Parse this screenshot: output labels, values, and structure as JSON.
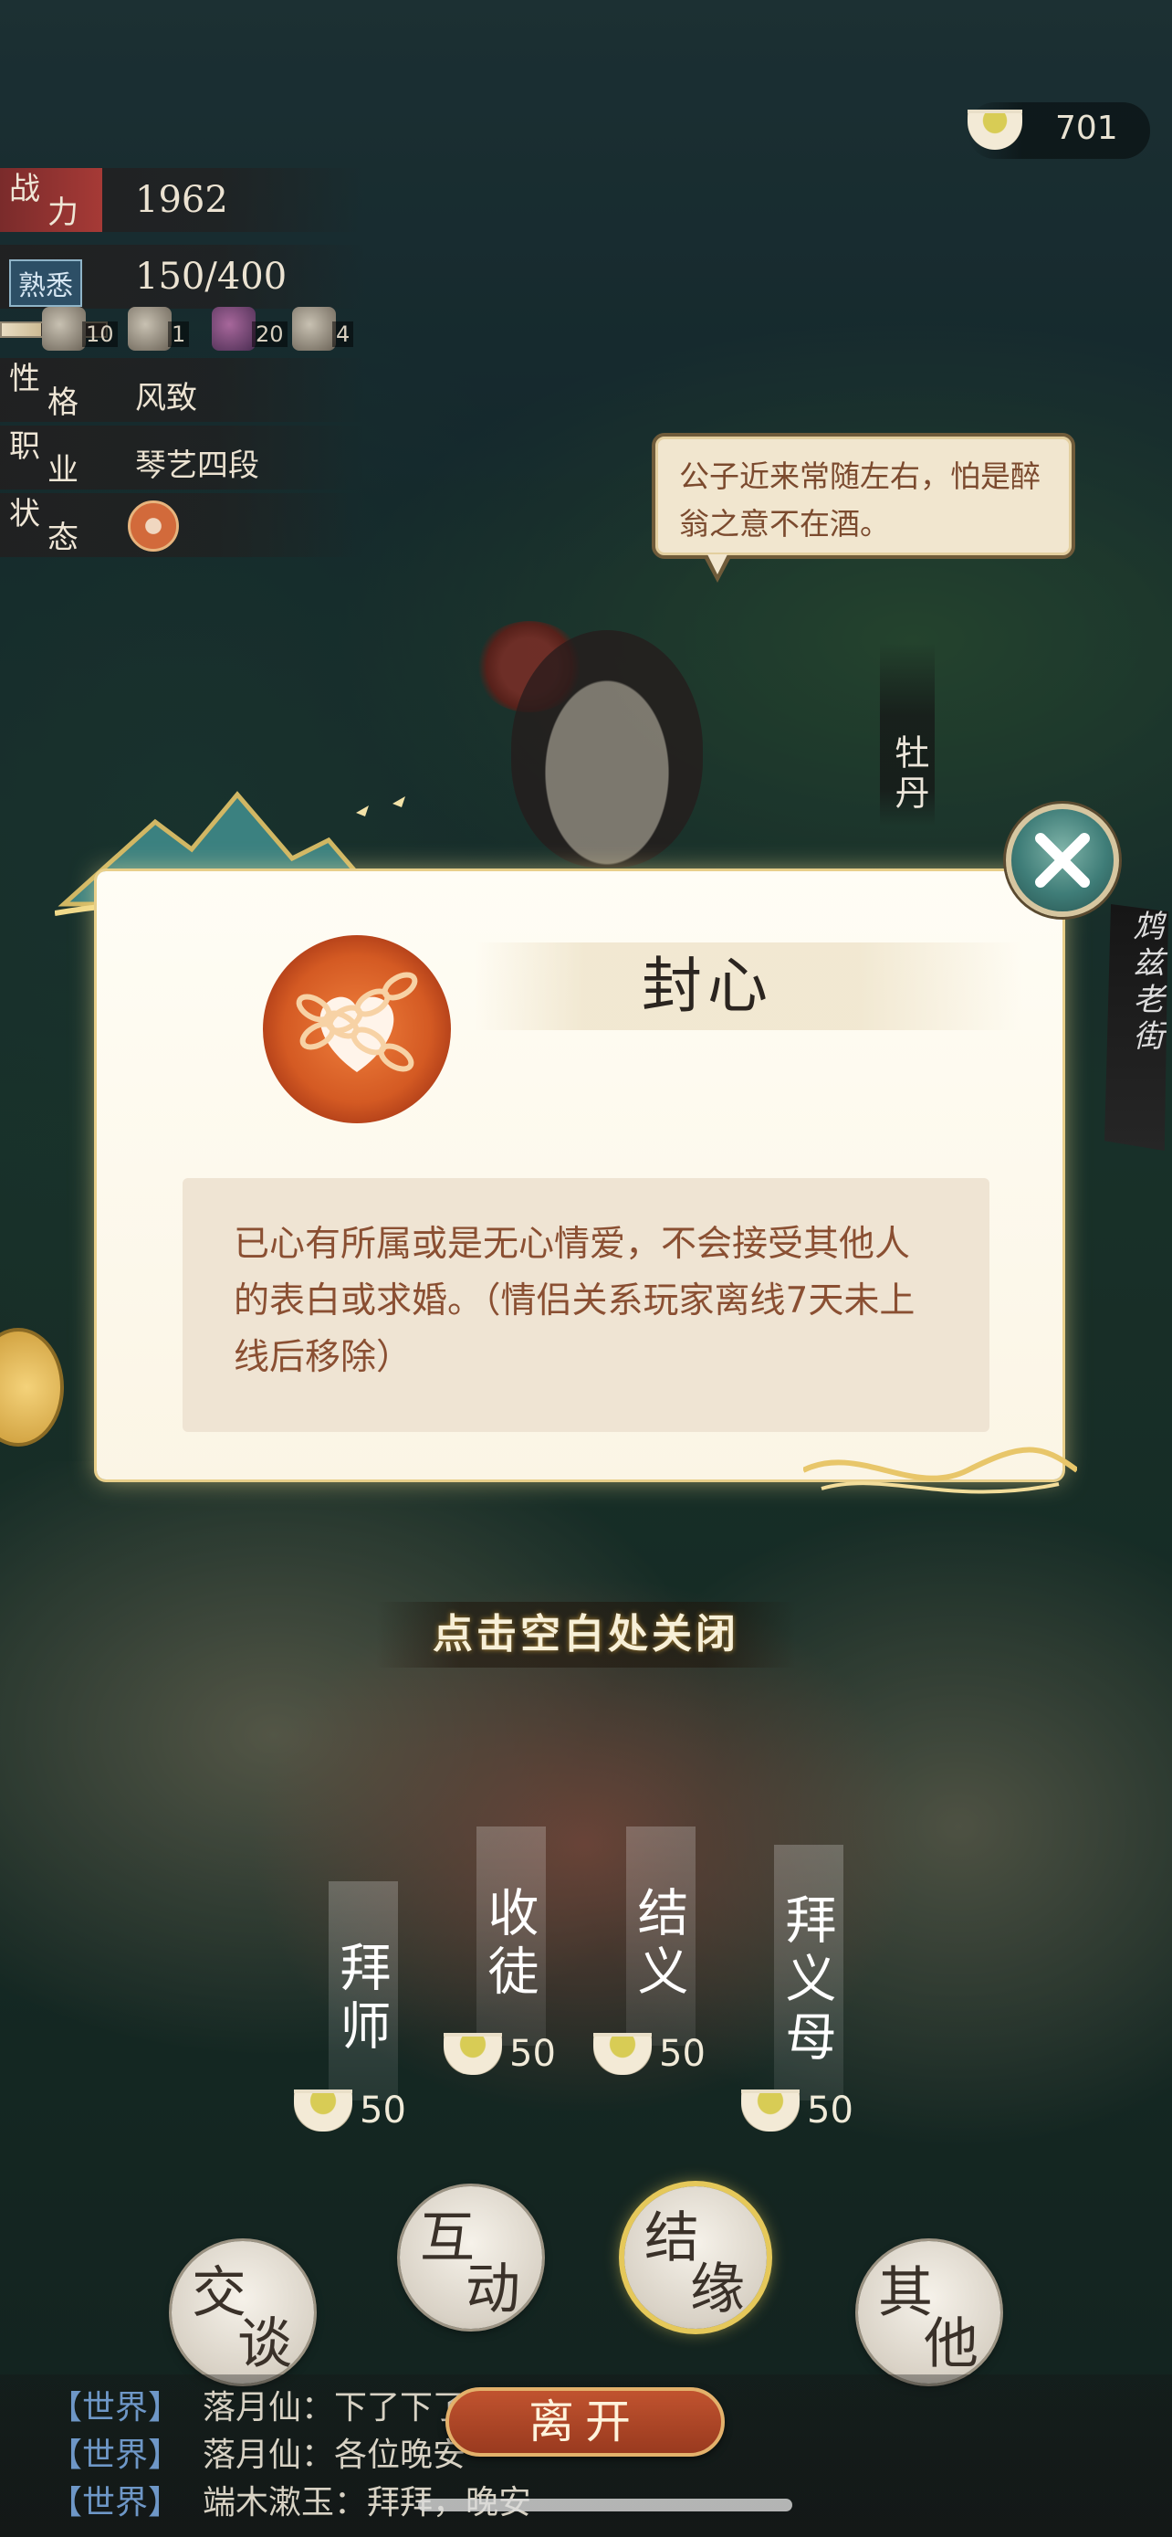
{
  "header": {
    "currency": {
      "icon": "tea-cup-icon",
      "value": "701"
    }
  },
  "stats": {
    "power": {
      "key1": "战",
      "key2": "力",
      "value": "1962"
    },
    "familiarity": {
      "badge": "熟悉",
      "value": "150/400",
      "progress": 0.375
    },
    "gifts": [
      {
        "icon": "star-gift-icon",
        "count": "10"
      },
      {
        "icon": "scroll-gift-icon",
        "count": "1"
      },
      {
        "icon": "gem-gift-icon",
        "count": "20"
      },
      {
        "icon": "fan-gift-icon",
        "count": "4"
      }
    ],
    "personality": {
      "key1": "性",
      "key2": "格",
      "value": "风致"
    },
    "occupation": {
      "key1": "职",
      "key2": "业",
      "value": "琴艺四段"
    },
    "status": {
      "key1": "状",
      "key2": "态",
      "icon": "sealed-heart-icon"
    }
  },
  "speech": "公子近来常随左右，怕是醉翁之意不在酒。",
  "character": {
    "name": "牡丹"
  },
  "location": "鸩兹老街",
  "modal": {
    "title": "封心",
    "icon": "sealed-heart-icon",
    "description": "已心有所属或是无心情爱，不会接受其他人的表白或求婚。（情侣关系玩家离线7天未上线后移除）",
    "close_icon": "close-icon"
  },
  "close_hint": "点击空白处关闭",
  "actions": [
    {
      "label": "拜师",
      "cost": "50"
    },
    {
      "label": "收徒",
      "cost": "50"
    },
    {
      "label": "结义",
      "cost": "50"
    },
    {
      "label": "拜义母",
      "cost": "50"
    }
  ],
  "bottom_buttons": [
    {
      "c1": "交",
      "c2": "谈"
    },
    {
      "c1": "互",
      "c2": "动"
    },
    {
      "c1": "结",
      "c2": "缘"
    },
    {
      "c1": "其",
      "c2": "他"
    }
  ],
  "chat": [
    {
      "channel": "【世界】",
      "text": "落月仙：下了下了"
    },
    {
      "channel": "【世界】",
      "text": "落月仙：各位晚安"
    },
    {
      "channel": "【世界】",
      "text": "端木漱玉：拜拜，晚安"
    }
  ],
  "leave_button": "离开",
  "colors": {
    "accent_gold": "#e5c85a",
    "modal_bg": "#fffdf5",
    "desc_text": "#8a4f32",
    "leave_red": "#9a3a1f"
  }
}
